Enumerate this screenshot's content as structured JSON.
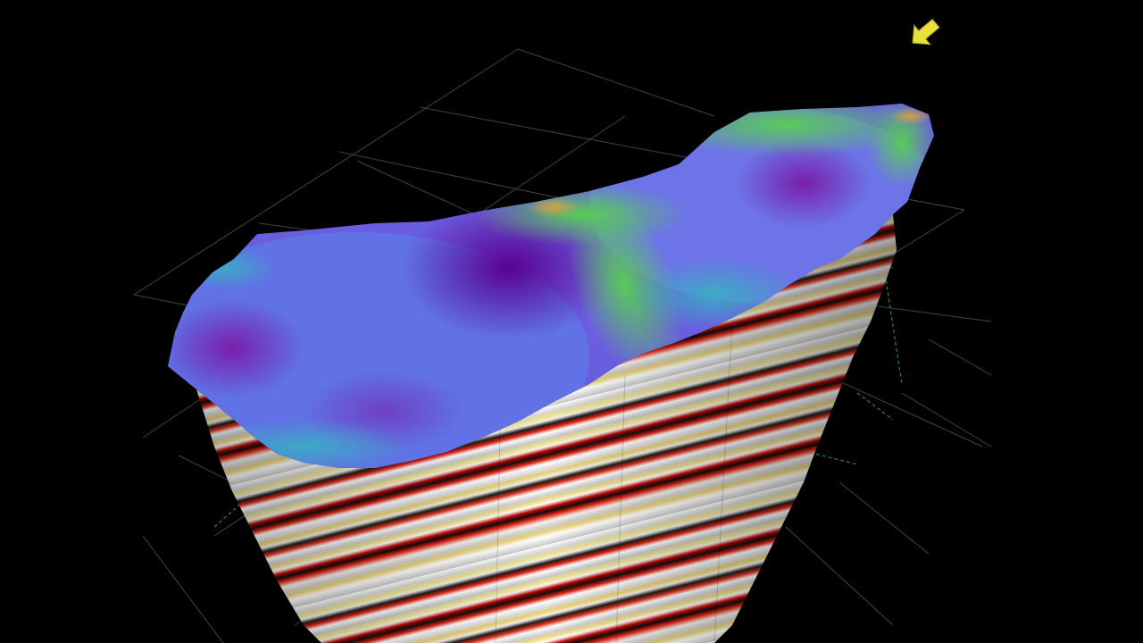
{
  "scene": {
    "subject": "seismic-volume",
    "background_color": "#000000",
    "grid_color": "#5a5a5a",
    "grid_accent_color": "#2fa37e",
    "surface_palette": [
      "#5a00a0",
      "#6a3cd8",
      "#5a7ae8",
      "#3aa6c8",
      "#4cd06a",
      "#9ae03a",
      "#e6a038"
    ],
    "seismic_palette": [
      "#ffffff",
      "#c8c8c8",
      "#e8d070",
      "#e02010",
      "#b00000",
      "#101010"
    ],
    "pointer_icon": "arrow-pointer-icon",
    "pointer_color": "#e6e23a"
  }
}
